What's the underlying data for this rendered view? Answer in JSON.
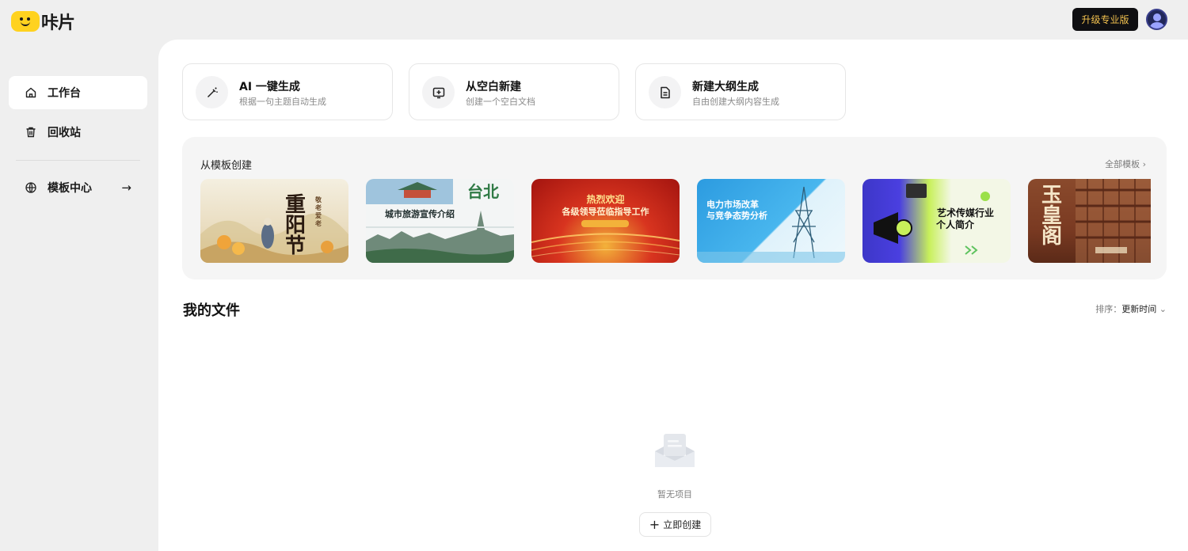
{
  "app": {
    "logo_text": "咔片",
    "brand_color": "#ffd21f"
  },
  "header": {
    "upgrade_label": "升级专业版",
    "upgrade_text_color": "#f2c14e"
  },
  "sidebar": {
    "items": [
      {
        "label": "工作台",
        "icon": "home-icon",
        "active": true
      },
      {
        "label": "回收站",
        "icon": "trash-icon",
        "active": false
      },
      {
        "label": "模板中心",
        "icon": "globe-icon",
        "arrow": "→"
      }
    ]
  },
  "actions": [
    {
      "title": "AI 一键生成",
      "subtitle": "根据一句主题自动生成",
      "icon": "magic-wand-icon"
    },
    {
      "title": "从空白新建",
      "subtitle": "创建一个空白文档",
      "icon": "add-slide-icon"
    },
    {
      "title": "新建大纲生成",
      "subtitle": "自由创建大纲内容生成",
      "icon": "outline-doc-icon"
    }
  ],
  "templates": {
    "title": "从模板创建",
    "view_all": "全部模板",
    "items": [
      {
        "label": "重阳节",
        "sub": "敬老爱老"
      },
      {
        "label": "城市旅游宣传介绍",
        "sub": "台北"
      },
      {
        "label": "热烈欢迎",
        "sub": "各级领导莅临指导工作"
      },
      {
        "label": "电力市场改革",
        "sub": "与竞争态势分析"
      },
      {
        "label": "艺术传媒行业",
        "sub": "个人简介"
      },
      {
        "label": "玉皇阁",
        "sub": ""
      }
    ]
  },
  "files": {
    "title": "我的文件",
    "sort_label": "排序：",
    "sort_value": "更新时间",
    "empty_text": "暂无项目",
    "create_label": "立即创建"
  }
}
